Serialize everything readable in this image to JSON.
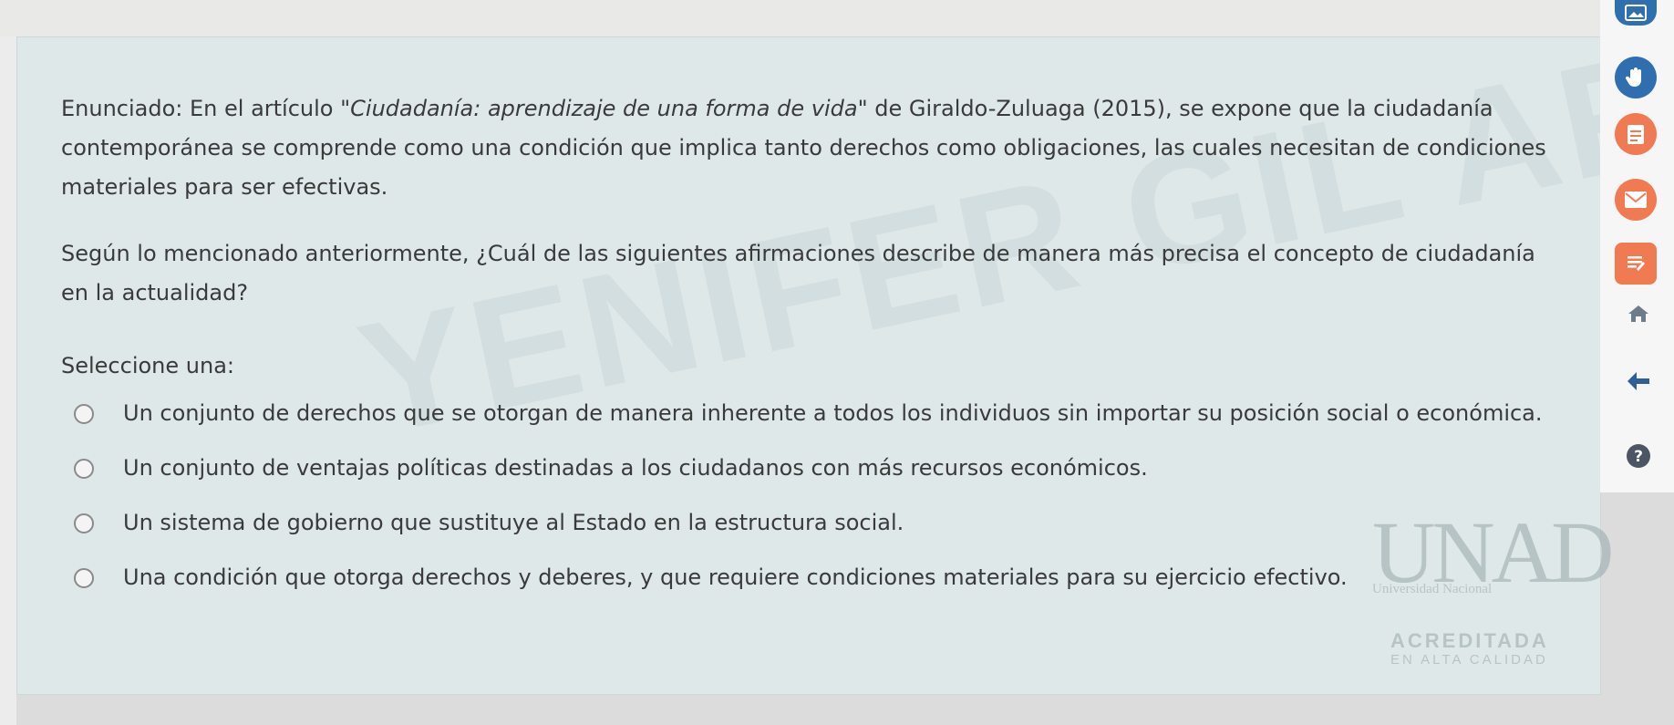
{
  "question": {
    "statement_prefix": "Enunciado: En el artículo \"",
    "article_title": "Ciudadanía: aprendizaje de una forma de vida",
    "statement_suffix": "\" de Giraldo-Zuluaga (2015), se expone que la ciudadanía contemporánea se comprende como una condición que implica tanto derechos como obligaciones, las cuales necesitan de condiciones materiales para ser efectivas.",
    "question_text": "Según lo mencionado anteriormente, ¿Cuál de las siguientes afirmaciones describe de manera más precisa el concepto de ciudadanía en la actualidad?",
    "prompt": "Seleccione una:",
    "options": [
      {
        "label": "Un conjunto de derechos que se otorgan de manera inherente a todos los individuos sin importar su posición social o económica."
      },
      {
        "label": "Un conjunto de ventajas políticas destinadas a los ciudadanos con más recursos económicos."
      },
      {
        "label": "Un sistema de gobierno que sustituye al Estado en la estructura social."
      },
      {
        "label": "Una condición que otorga derechos y deberes, y que requiere condiciones materiales para su ejercicio efectivo."
      }
    ],
    "selected": null
  },
  "watermark": {
    "text": "YENIFER GIL ARIAS"
  },
  "logo": {
    "brand": "UNAD",
    "line1": "Universidad Nacional",
    "line2": "ACREDITADA",
    "line3": "EN ALTA CALIDAD"
  },
  "sidebar": {
    "icons": [
      "image-icon",
      "hand-icon",
      "calendar-icon",
      "mail-icon",
      "notes-icon",
      "home-icon",
      "back-arrow-icon",
      "help-icon"
    ],
    "colors": {
      "blue": "#2f6fb0",
      "orange": "#f07a52",
      "blue_dark": "#2e5f96"
    }
  }
}
